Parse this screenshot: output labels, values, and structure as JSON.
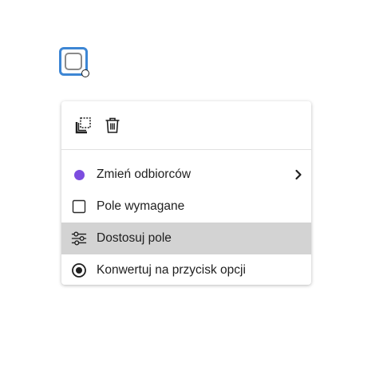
{
  "field": {
    "selection_color": "#3d86d4"
  },
  "toolbar": {
    "duplicate_icon": "duplicate-icon",
    "delete_icon": "trash-icon"
  },
  "menu": {
    "items": [
      {
        "label": "Zmień odbiorców",
        "icon": "recipient-dot-icon",
        "icon_color": "#7c4ddf",
        "has_submenu": true
      },
      {
        "label": "Pole wymagane",
        "icon": "checkbox-icon",
        "checked": false
      },
      {
        "label": "Dostosuj pole",
        "icon": "sliders-icon",
        "highlighted": true
      },
      {
        "label": "Konwertuj na przycisk opcji",
        "icon": "radio-icon"
      }
    ]
  },
  "colors": {
    "highlight": "#d3d3d3",
    "text": "#1f1f1f",
    "recipient": "#7c4ddf"
  }
}
